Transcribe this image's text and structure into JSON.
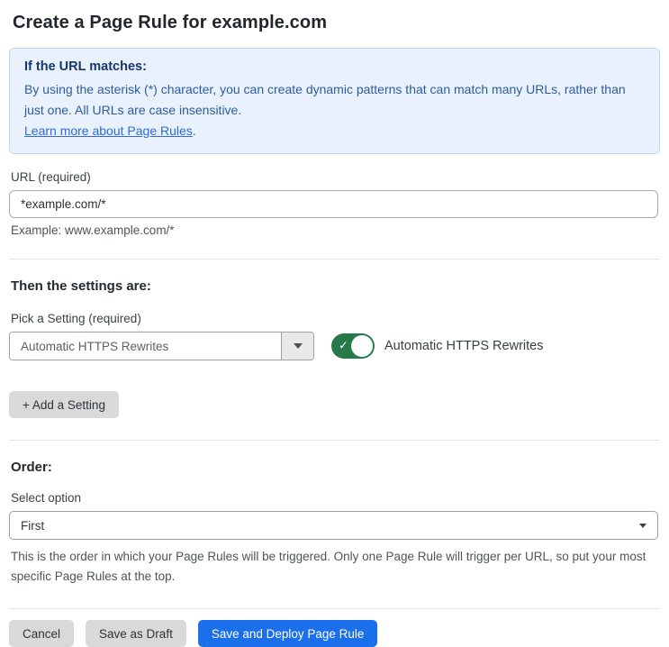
{
  "page": {
    "title": "Create a Page Rule for example.com"
  },
  "info_box": {
    "heading": "If the URL matches:",
    "body": "By using the asterisk (*) character, you can create dynamic patterns that can match many URLs, rather than just one. All URLs are case insensitive.",
    "link": "Learn more about Page Rules",
    "link_suffix": "."
  },
  "url_field": {
    "label": "URL (required)",
    "value": "*example.com/*",
    "hint": "Example: www.example.com/*"
  },
  "settings": {
    "heading": "Then the settings are:",
    "picker_label": "Pick a Setting (required)",
    "picker_value": "Automatic HTTPS Rewrites",
    "toggle_state": "on",
    "toggle_check": "✓",
    "toggle_label": "Automatic HTTPS Rewrites",
    "add_setting_label": "+ Add a Setting"
  },
  "order": {
    "heading": "Order:",
    "select_label": "Select option",
    "select_value": "First",
    "help": "This is the order in which your Page Rules will be triggered. Only one Page Rule will trigger per URL, so put your most specific Page Rules at the top."
  },
  "footer": {
    "cancel_label": "Cancel",
    "save_draft_label": "Save as Draft",
    "save_deploy_label": "Save and Deploy Page Rule"
  },
  "colors": {
    "info_bg": "#e9f2fc",
    "info_border": "#bcd8f3",
    "info_heading": "#17356b",
    "info_text": "#2b5d9e",
    "link": "#2f6bd9",
    "toggle_on": "#27794a",
    "primary_button": "#1b6fea",
    "gray_button": "#d9d9d9"
  }
}
